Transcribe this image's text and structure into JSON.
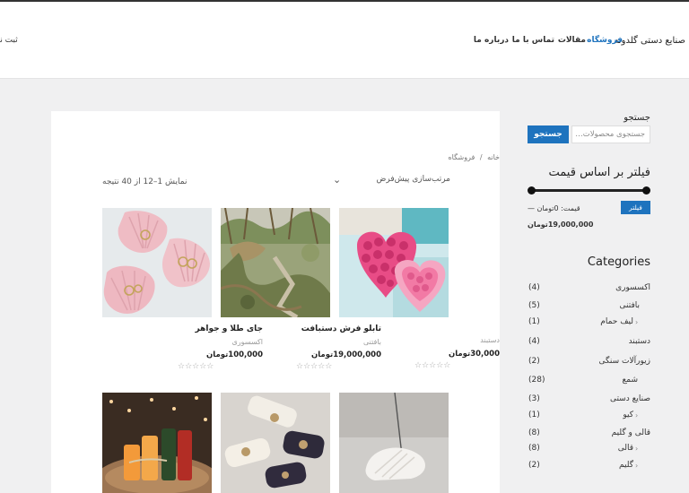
{
  "header": {
    "brand": "صنایع دستی گلدونه",
    "nav": [
      {
        "label": "فروشگاه",
        "active": true
      },
      {
        "label": "مقالات",
        "active": false
      },
      {
        "label": "تماس با ما",
        "active": false
      },
      {
        "label": "درباره ما",
        "active": false
      }
    ],
    "register_label": "ثبت نام"
  },
  "breadcrumb": {
    "home": "خانه",
    "sep": "/",
    "current": "فروشگاه"
  },
  "sort": {
    "selected": "مرتب‌سازی پیش‌فرض"
  },
  "result_count": "نمایش 1–12 از 40 نتیجه",
  "products": [
    {
      "name": "",
      "category": "دستبند",
      "price": "30,000تومان",
      "stars": "☆☆☆☆☆",
      "image": "pink-rose-heart-candle"
    },
    {
      "name": "تابلو فرش دستبافت",
      "category": "بافتنی",
      "price": "19,000,000تومان",
      "stars": "☆☆☆☆☆",
      "image": "woven-landscape-rug"
    },
    {
      "name": "جای طلا و جواهر",
      "category": "اکسسوری",
      "price": "100,000تومان",
      "stars": "☆☆☆☆☆",
      "image": "pink-shell-jewelry-dish"
    },
    {
      "name": "",
      "category": "",
      "price": "",
      "stars": "",
      "image": "shell-incense-holder"
    },
    {
      "name": "",
      "category": "",
      "price": "",
      "stars": "",
      "image": "beeswax-candles-bundle"
    },
    {
      "name": "",
      "category": "",
      "price": "",
      "stars": "",
      "image": "colored-candles-on-wood"
    }
  ],
  "sidebar": {
    "search_title": "جستجو",
    "search_placeholder": "جستجوی محصولات…",
    "search_button": "جستجو",
    "price_filter_title": "فیلتر بر اساس قیمت",
    "filter_button": "فیلتر",
    "price_label": "قیمت: 0تومان —",
    "price_max": "19,000,000تومان",
    "categories_title": "Categories",
    "categories": [
      {
        "name": "اکسسوری",
        "count": "(4)",
        "child": false
      },
      {
        "name": "بافتنی",
        "count": "(5)",
        "child": false
      },
      {
        "name": "لیف حمام",
        "count": "(1)",
        "child": true
      },
      {
        "name": "دستبند",
        "count": "(4)",
        "child": false
      },
      {
        "name": "زیورآلات سنگی",
        "count": "(2)",
        "child": false
      },
      {
        "name": "شمع",
        "count": "(28)",
        "child": false
      },
      {
        "name": "صنایع دستی",
        "count": "(3)",
        "child": false
      },
      {
        "name": "کیو",
        "count": "(1)",
        "child": true
      },
      {
        "name": "قالی و گلیم",
        "count": "(8)",
        "child": false
      },
      {
        "name": "قالی",
        "count": "(8)",
        "child": true
      },
      {
        "name": "گلیم",
        "count": "(2)",
        "child": true
      }
    ]
  },
  "colors": {
    "accent": "#1e73be",
    "background": "#f0f0f1"
  }
}
